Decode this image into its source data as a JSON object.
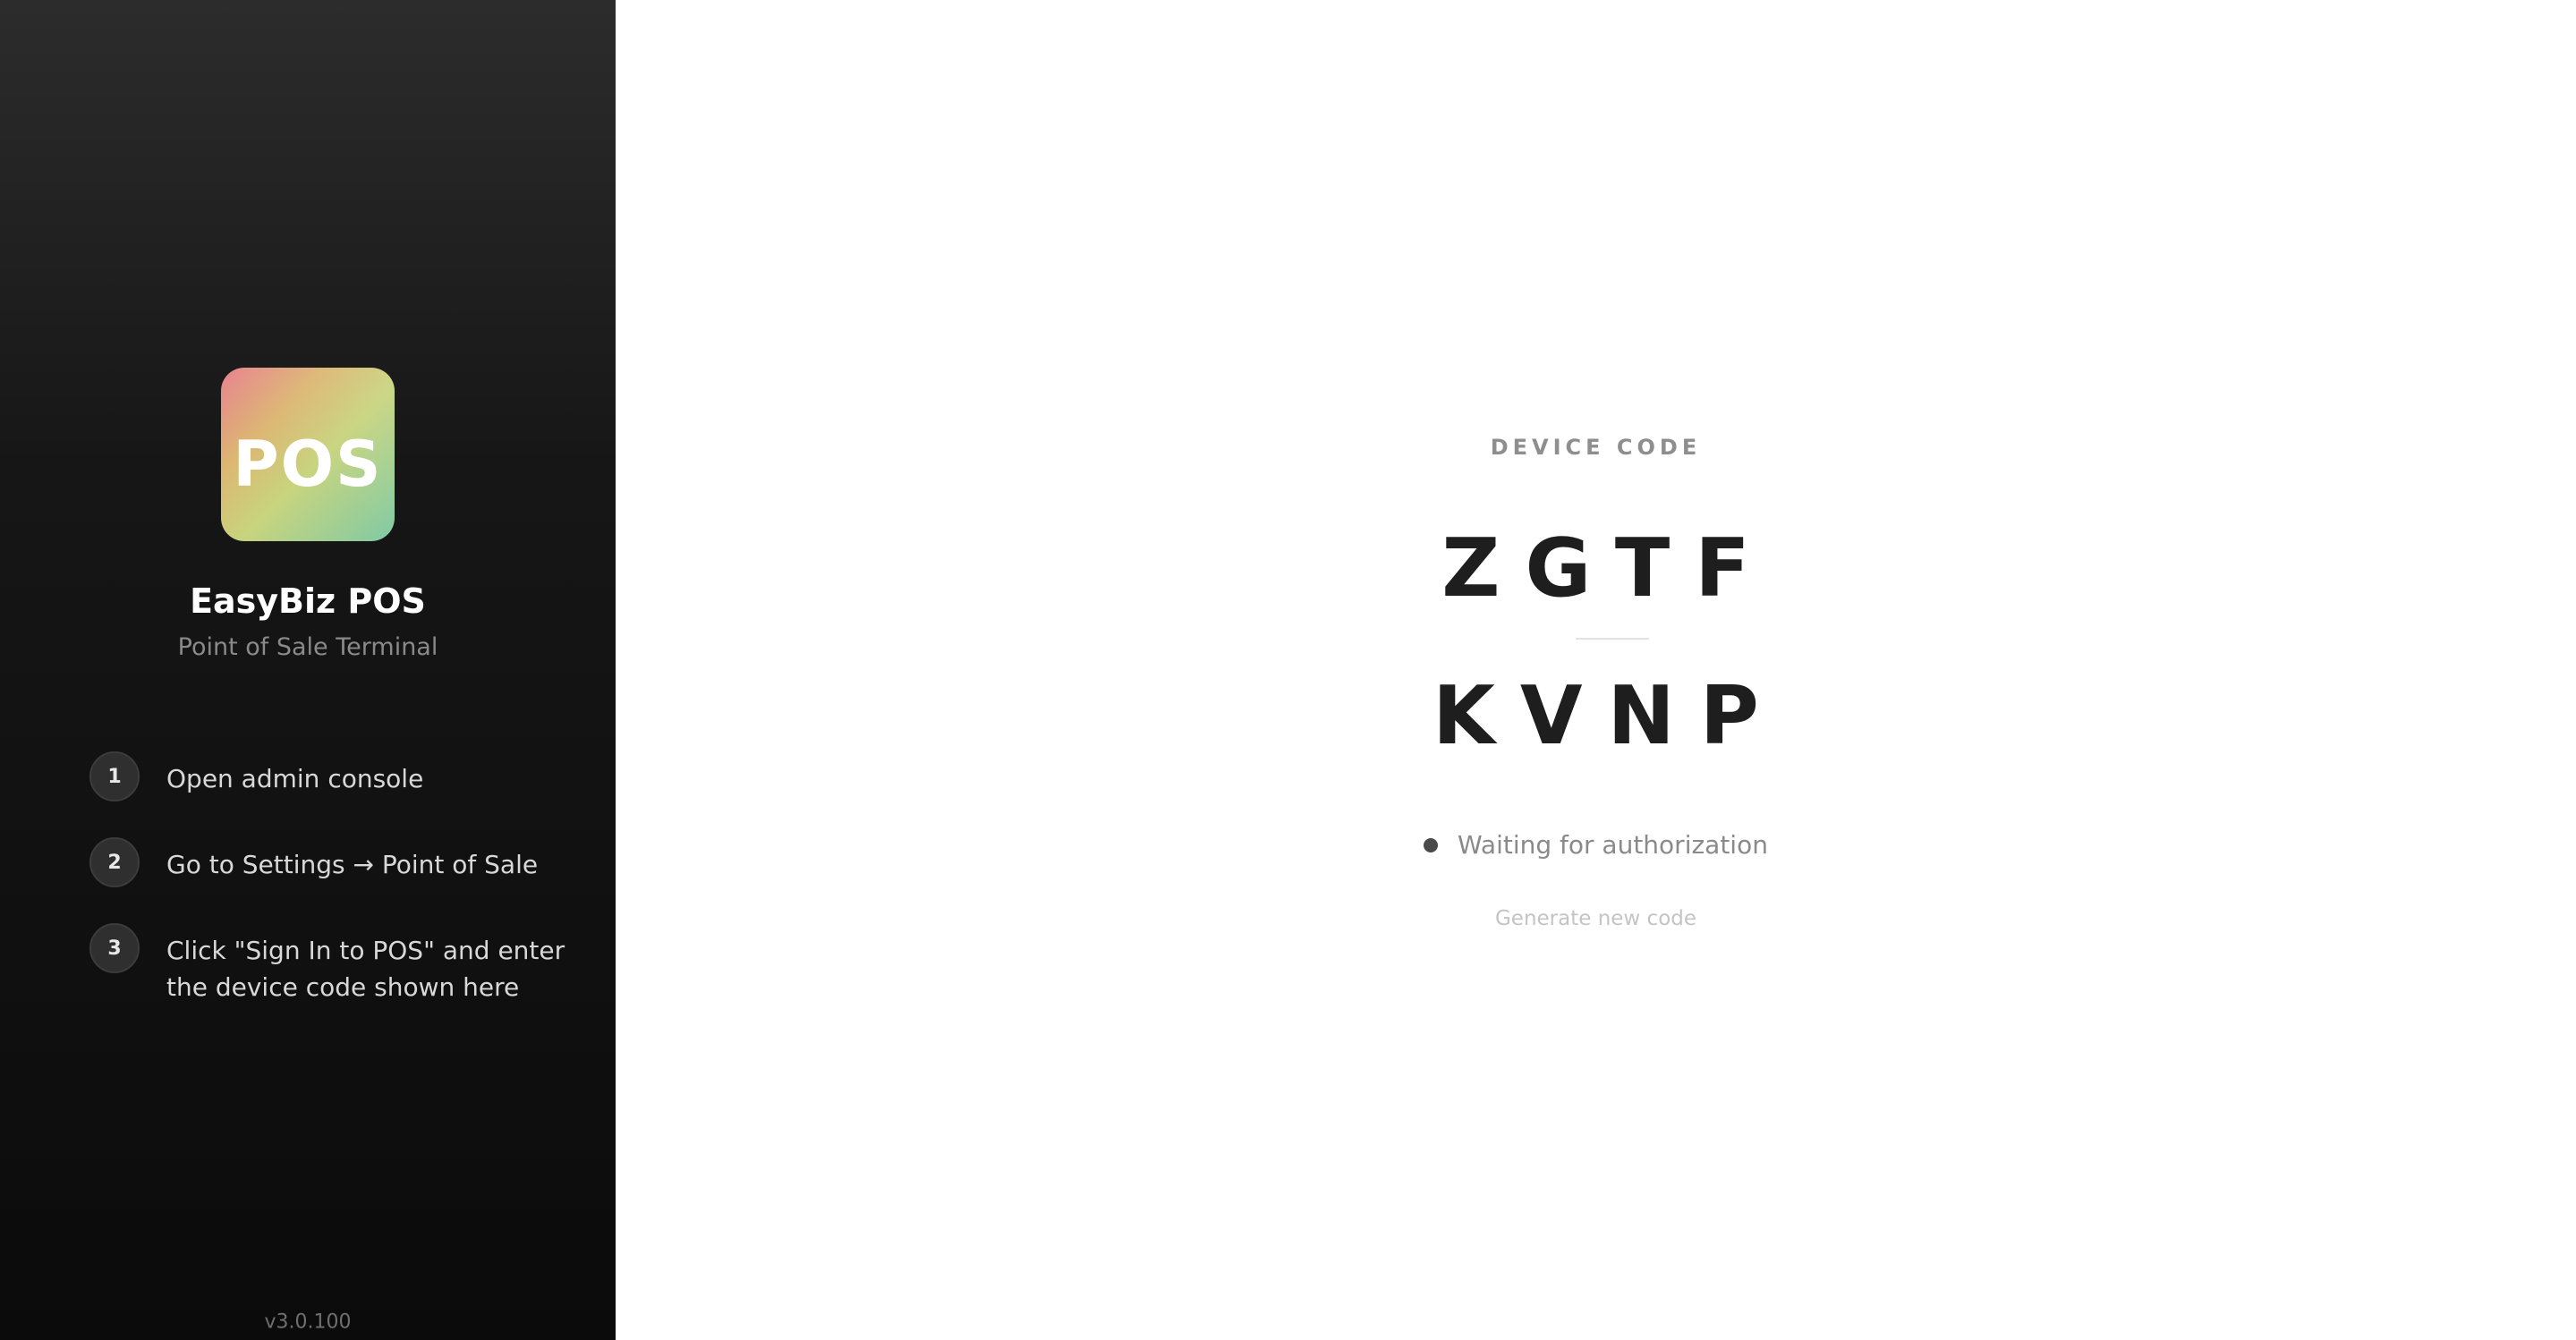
{
  "sidebar": {
    "logo_text": "POS",
    "app_title": "EasyBiz POS",
    "app_subtitle": "Point of Sale Terminal",
    "steps": [
      {
        "number": "1",
        "text": "Open admin console"
      },
      {
        "number": "2",
        "text": "Go to Settings → Point of Sale"
      },
      {
        "number": "3",
        "text": "Click \"Sign In to POS\" and enter\nthe device code shown here"
      }
    ],
    "version": "v3.0.100"
  },
  "main": {
    "device_code_label": "DEVICE CODE",
    "code_row_1": "ZGTF",
    "code_row_2": "KVNP",
    "status_text": "Waiting for authorization",
    "regenerate_label": "Generate new code"
  },
  "colors": {
    "sidebar_bg": "#161616",
    "logo_gradient": [
      "#e8818e",
      "#dcb773",
      "#c8d47e",
      "#7fcaa5"
    ],
    "code_text": "#1e1e1e",
    "status_dot": "#4a4a4a"
  },
  "icons": {
    "status": "status-dot-icon"
  }
}
